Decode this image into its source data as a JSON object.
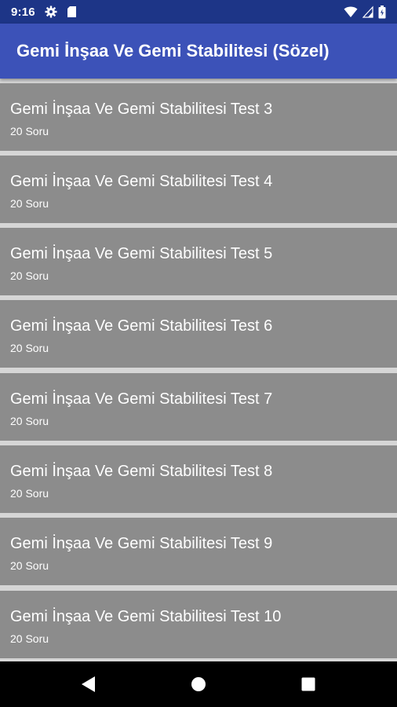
{
  "status_bar": {
    "time": "9:16"
  },
  "app_bar": {
    "title": "Gemi İnşaa Ve Gemi Stabilitesi (Sözel)"
  },
  "tests": [
    {
      "title": "Gemi İnşaa Ve Gemi Stabilitesi Test 3",
      "subtitle": "20 Soru"
    },
    {
      "title": "Gemi İnşaa Ve Gemi Stabilitesi Test 4",
      "subtitle": "20 Soru"
    },
    {
      "title": "Gemi İnşaa Ve Gemi Stabilitesi Test 5",
      "subtitle": "20 Soru"
    },
    {
      "title": "Gemi İnşaa Ve Gemi Stabilitesi Test 6",
      "subtitle": "20 Soru"
    },
    {
      "title": "Gemi İnşaa Ve Gemi Stabilitesi Test 7",
      "subtitle": "20 Soru"
    },
    {
      "title": "Gemi İnşaa Ve Gemi Stabilitesi Test 8",
      "subtitle": "20 Soru"
    },
    {
      "title": "Gemi İnşaa Ve Gemi Stabilitesi Test 9",
      "subtitle": "20 Soru"
    },
    {
      "title": "Gemi İnşaa Ve Gemi Stabilitesi Test 10",
      "subtitle": "20 Soru"
    }
  ],
  "icons": {
    "status_left": [
      "gear-icon",
      "sd-card-icon"
    ],
    "status_right": [
      "wifi-icon",
      "cellular-signal-icon",
      "battery-icon"
    ],
    "nav": [
      "back-icon",
      "home-icon",
      "recents-icon"
    ]
  },
  "colors": {
    "status_bar": "#1d3587",
    "app_bar": "#3c52b8",
    "list_item": "#8c8c8c",
    "list_background": "#d6d6d6",
    "nav_bar": "#000000"
  }
}
